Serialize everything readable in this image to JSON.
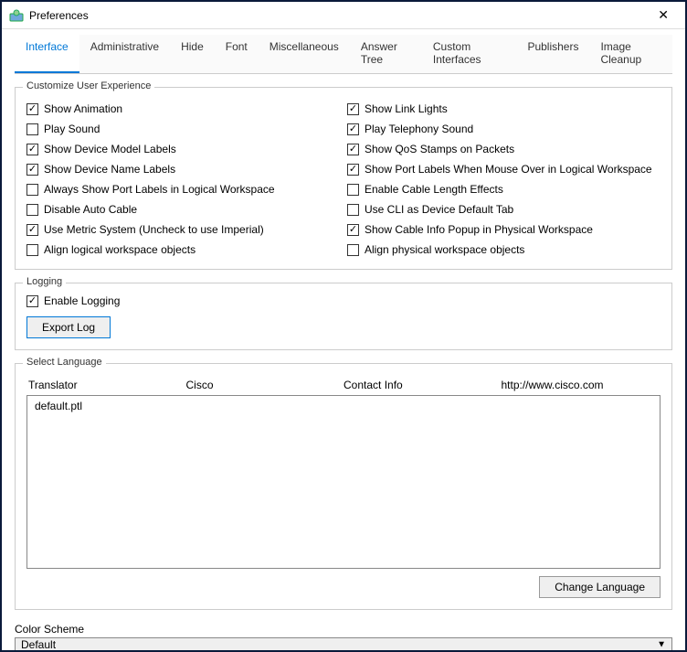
{
  "window": {
    "title": "Preferences"
  },
  "tabs": [
    {
      "label": "Interface",
      "active": true
    },
    {
      "label": "Administrative",
      "active": false
    },
    {
      "label": "Hide",
      "active": false
    },
    {
      "label": "Font",
      "active": false
    },
    {
      "label": "Miscellaneous",
      "active": false
    },
    {
      "label": "Answer Tree",
      "active": false
    },
    {
      "label": "Custom Interfaces",
      "active": false
    },
    {
      "label": "Publishers",
      "active": false
    },
    {
      "label": "Image Cleanup",
      "active": false
    }
  ],
  "ux_group_title": "Customize User Experience",
  "ux_left": [
    {
      "label": "Show Animation",
      "checked": true
    },
    {
      "label": "Play Sound",
      "checked": false
    },
    {
      "label": "Show Device Model Labels",
      "checked": true
    },
    {
      "label": "Show Device Name Labels",
      "checked": true
    },
    {
      "label": "Always Show Port Labels in Logical Workspace",
      "checked": false
    },
    {
      "label": "Disable Auto Cable",
      "checked": false
    },
    {
      "label": "Use Metric System (Uncheck to use Imperial)",
      "checked": true
    },
    {
      "label": "Align logical workspace objects",
      "checked": false
    }
  ],
  "ux_right": [
    {
      "label": "Show Link Lights",
      "checked": true
    },
    {
      "label": "Play Telephony Sound",
      "checked": true
    },
    {
      "label": "Show QoS Stamps on Packets",
      "checked": true
    },
    {
      "label": "Show Port Labels When Mouse Over in Logical Workspace",
      "checked": true
    },
    {
      "label": "Enable Cable Length Effects",
      "checked": false
    },
    {
      "label": "Use CLI as Device Default Tab",
      "checked": false
    },
    {
      "label": "Show Cable Info Popup in Physical Workspace",
      "checked": true
    },
    {
      "label": "Align physical workspace objects",
      "checked": false
    }
  ],
  "logging": {
    "group_title": "Logging",
    "enable_label": "Enable Logging",
    "enable_checked": true,
    "export_button": "Export Log"
  },
  "language": {
    "group_title": "Select Language",
    "headers": {
      "translator": "Translator",
      "vendor": "Cisco",
      "contact": "Contact Info",
      "url": "http://www.cisco.com"
    },
    "items": [
      "default.ptl"
    ],
    "change_button": "Change Language"
  },
  "color_scheme": {
    "label": "Color Scheme",
    "value": "Default"
  }
}
